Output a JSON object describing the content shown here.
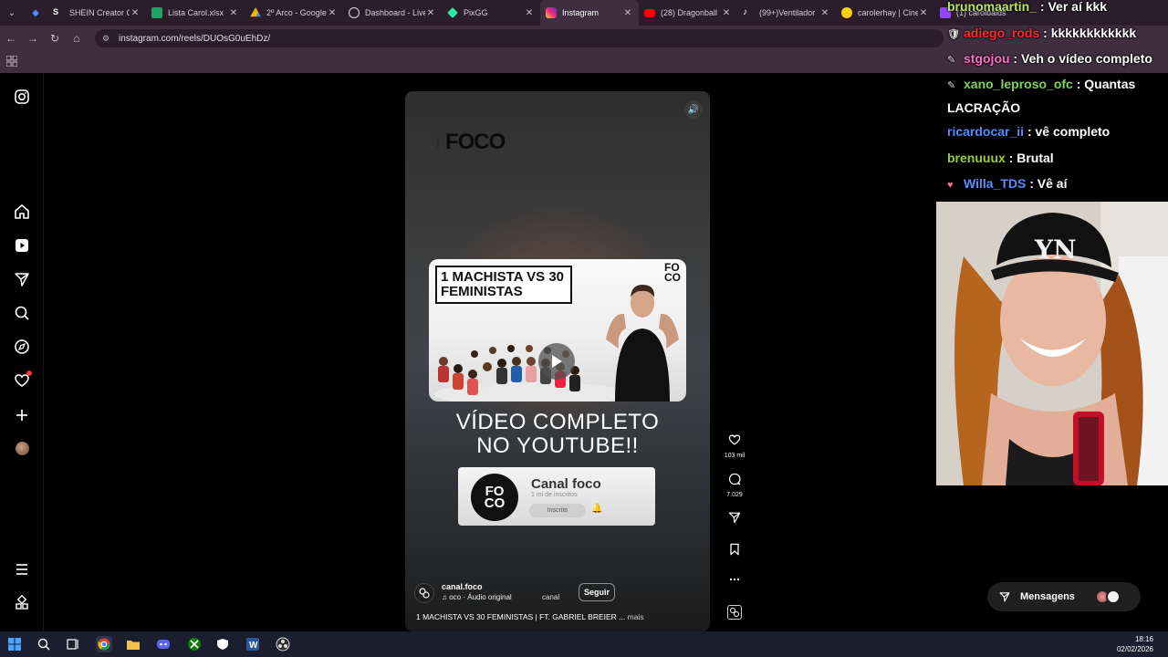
{
  "browser": {
    "tabs": [
      {
        "label": "SHEIN Creator C",
        "favicon_color": "#ffffff",
        "favicon_text": "S"
      },
      {
        "label": "Lista Carol.xlsx",
        "favicon_color": "#21a366",
        "favicon_text": ""
      },
      {
        "label": "2º Arco - Google",
        "favicon_color": "#f4b400",
        "favicon_text": ""
      },
      {
        "label": "Dashboard - Live",
        "favicon_color": "#e0e0e0",
        "favicon_text": ""
      },
      {
        "label": "PixGG",
        "favicon_color": "#2ee6a6",
        "favicon_text": ""
      },
      {
        "label": "Instagram",
        "favicon_color": "#e1306c",
        "favicon_text": ""
      },
      {
        "label": "(28) Dragonball",
        "favicon_color": "#ff0000",
        "favicon_text": ""
      },
      {
        "label": "(99+)Ventilador",
        "favicon_color": "#ffffff",
        "favicon_text": ""
      },
      {
        "label": "carolerhay | Cine",
        "favicon_color": "#f6d00c",
        "favicon_text": ""
      },
      {
        "label": "(1) carolbaids",
        "favicon_color": "#9146ff",
        "favicon_text": ""
      }
    ],
    "active_tab": 5,
    "url": "instagram.com/reels/DUOsG0uEhDz/"
  },
  "reel": {
    "brand_small": "canal",
    "brand": "FOCO",
    "thumb_title": "1 MACHISTA VS 30 FEMINISTAS",
    "thumb_brand_top": "FO",
    "thumb_brand_bottom": "CO",
    "video_text_line1": "VÍDEO COMPLETO",
    "video_text_line2": "NO YOUTUBE!!",
    "yt_avatar_top": "FO",
    "yt_avatar_bottom": "CO",
    "yt_channel": "Canal foco",
    "yt_subs": "1 mi de inscritos",
    "yt_subscribed": "Inscrito",
    "author": "canal.foco",
    "audio": "♫ oco · Áudio original",
    "audio_extra": "canal",
    "follow": "Seguir",
    "caption": "1 MACHISTA VS 30 FEMINISTAS | FT. GABRIEL BREIER ...",
    "more": "mais",
    "likes": "103 mil",
    "comments": "7.029"
  },
  "chat": [
    {
      "user": "brunomaartin_",
      "text": "Ver aí kkk",
      "color": "#b8e65c",
      "badge": ""
    },
    {
      "user": "adiego_rods",
      "text": "kkkkkkkkkkkk",
      "color": "#ff2a2a",
      "badge": "🛡"
    },
    {
      "user": "stgojou",
      "text": "Veh o vídeo completo",
      "color": "#ff6ec7",
      "badge": "✎"
    },
    {
      "user": "xano_leproso_ofc",
      "text": "Quantas LACRAÇÃO",
      "color": "#7fd35a",
      "badge": "✎"
    },
    {
      "user": "ricardocar_ii",
      "text": "vê completo",
      "color": "#4f8cff",
      "badge": ""
    },
    {
      "user": "brenuuux",
      "text": "Brutal",
      "color": "#9acd32",
      "badge": ""
    },
    {
      "user": "Willa_TDS",
      "text": "Vê aí",
      "color": "#5b8cff",
      "badge": "♥"
    }
  ],
  "messages": {
    "label": "Mensagens"
  },
  "taskbar": {
    "time": "18:16",
    "date": "02/02/2026"
  },
  "colors": {
    "accent_like": "#ff3040",
    "tab_bg": "#2b1d2c",
    "toolbar_bg": "#3f2d40"
  }
}
